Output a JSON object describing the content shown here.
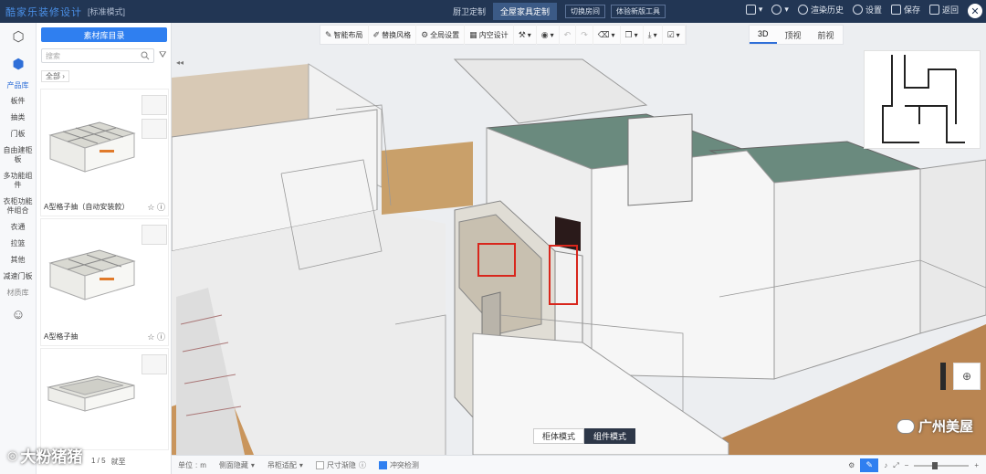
{
  "topbar": {
    "brand": "酷家乐装修设计",
    "mode": "[标准模式]",
    "tabs": [
      "厨卫定制",
      "全屋家具定制"
    ],
    "active_tab": 1,
    "buttons": [
      "切换房间",
      "体验新版工具"
    ],
    "right": [
      "渲染历史",
      "设置",
      "保存",
      "返回"
    ]
  },
  "iconcol": {
    "product_lib": "产品库",
    "categories": [
      "板件",
      "抽类",
      "门板",
      "自由建柜板",
      "多功能组件",
      "衣柜功能件组合",
      "衣通",
      "拉篮",
      "其他",
      "减速门板"
    ],
    "material_lib": "材质库"
  },
  "panel": {
    "dir_button": "素材库目录",
    "search_placeholder": "搜索",
    "crumb": "全部",
    "cards": [
      {
        "name": "A型格子抽（自动安装款）"
      },
      {
        "name": "A型格子抽"
      },
      {
        "name": ""
      }
    ]
  },
  "toolbar": {
    "tools": [
      "智能布局",
      "替换风格",
      "全局设置",
      "内空设计"
    ],
    "view_tabs": [
      "3D",
      "顶视",
      "前视"
    ],
    "active_view": 0
  },
  "modes": {
    "items": [
      "柜体模式",
      "组件模式"
    ],
    "active": 1
  },
  "bottombar": {
    "unit_label": "单位",
    "unit_value": "m",
    "items": [
      "侧面隐藏",
      "吊柜适配"
    ],
    "dim_label": "尺寸渐隐",
    "collision_label": "冲突检测"
  },
  "watermark_left": "大粉猪猪",
  "watermark_right": "广州美屋",
  "pager": "1 / 5",
  "bottom_tail": "就至"
}
